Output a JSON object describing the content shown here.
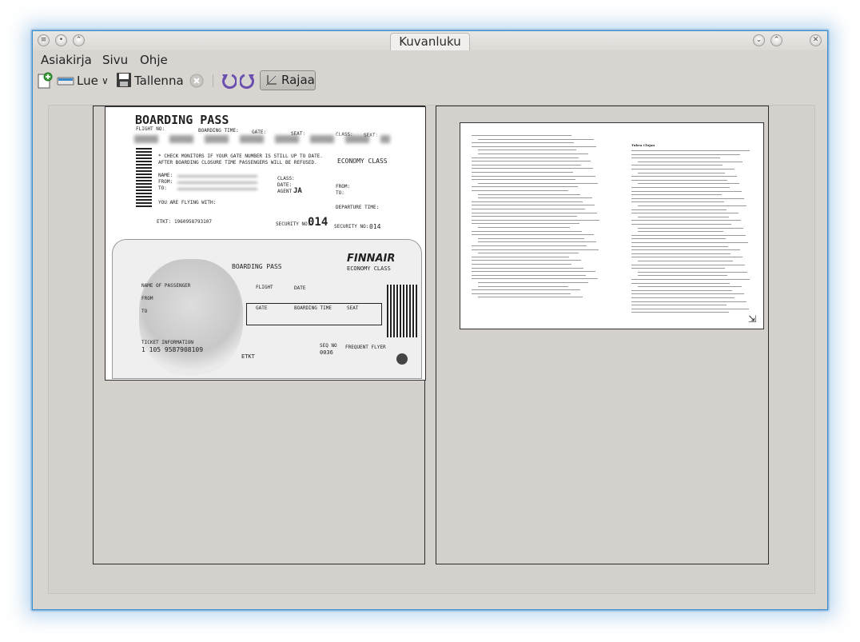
{
  "window": {
    "title": "Kuvanluku"
  },
  "menubar": {
    "items": [
      {
        "label": "Asiakirja"
      },
      {
        "label": "Sivu"
      },
      {
        "label": "Ohje"
      }
    ]
  },
  "toolbar": {
    "scan_label": "Lue",
    "save_label": "Tallenna",
    "crop_label": "Rajaa"
  },
  "pages": [
    {
      "boarding_pass_top": {
        "title": "BOARDING PASS",
        "flight_no": "FLIGHT NO:",
        "boarding_time": "BOARDING TIME:",
        "gate": "GATE:",
        "seat": "SEAT:",
        "class": "CLASS:",
        "seat2": "SEAT:",
        "notice1": "* CHECK MONITORS IF YOUR GATE NUMBER IS STILL UP TO DATE.",
        "notice2": "AFTER BOARDING CLOSURE TIME PASSENGERS WILL BE REFUSED.",
        "economy": "ECONOMY CLASS",
        "name": "NAME:",
        "from": "FROM:",
        "to": "TO:",
        "class2": "CLASS:",
        "date": "DATE:",
        "agent": "AGENT",
        "agent_value": "JA",
        "from2": "FROM:",
        "to2": "TO:",
        "flying_with": "YOU ARE FLYING WITH:",
        "departure": "DEPARTURE TIME:",
        "etkt": "ETKT:",
        "etkt_value": "1960958793107",
        "security_no": "SECURITY NO:",
        "security_value": "014",
        "security_no2": "SECURITY NO:",
        "security_value2": "014"
      },
      "boarding_pass_bottom": {
        "airline": "FINNAIR",
        "title": "BOARDING PASS",
        "economy": "ECONOMY CLASS",
        "name_of_passenger": "NAME OF PASSENGER",
        "from": "FROM",
        "to": "TO",
        "flight": "FLIGHT",
        "date": "DATE",
        "gate": "GATE",
        "boarding_time": "BOARDING TIME",
        "seat": "SEAT",
        "ticket_info": "TICKET INFORMATION",
        "ticket_number": "1 105 9587908109",
        "etkt": "ETKT",
        "seq_no": "SEQ NO",
        "seq_value": "0036",
        "frequent_flyer": "FREQUENT FLYER"
      }
    },
    {
      "document_heading": "Tukea Clojan"
    }
  ]
}
